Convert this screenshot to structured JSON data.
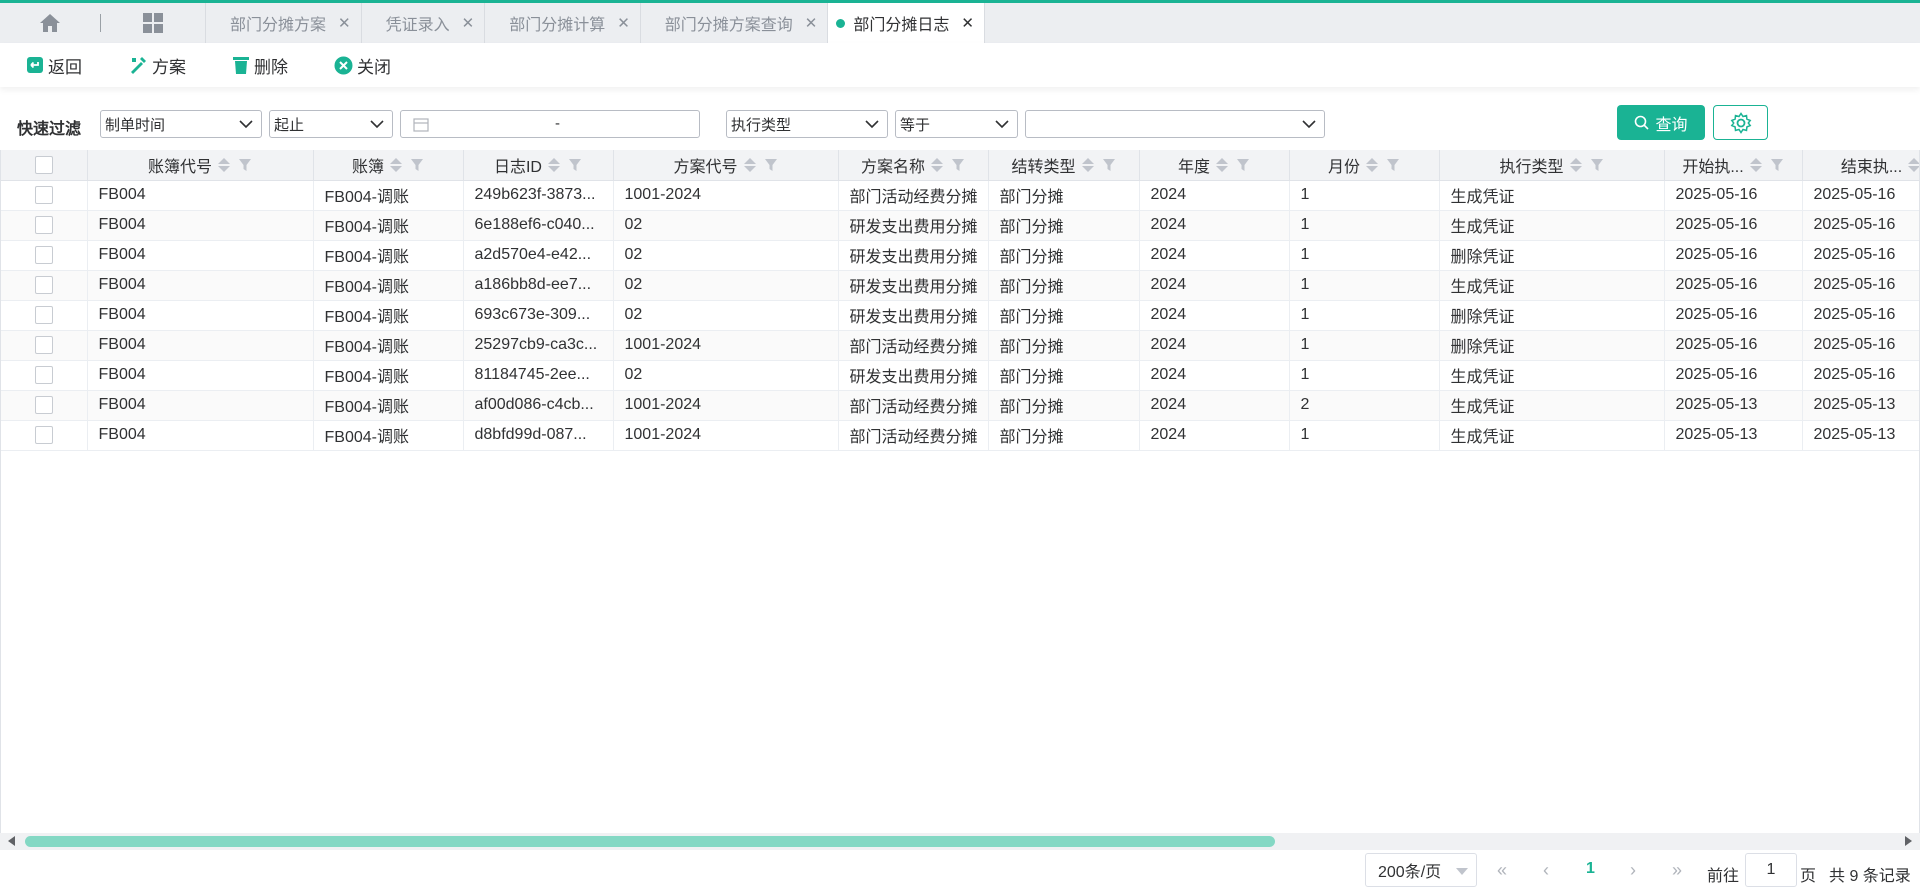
{
  "tabs": [
    {
      "label": "部门分摊方案",
      "active": false
    },
    {
      "label": "凭证录入",
      "active": false
    },
    {
      "label": "部门分摊计算",
      "active": false
    },
    {
      "label": "部门分摊方案查询",
      "active": false
    },
    {
      "label": "部门分摊日志",
      "active": true
    }
  ],
  "toolbar": {
    "back": "返回",
    "scheme": "方案",
    "delete": "删除",
    "close": "关闭"
  },
  "filter": {
    "label": "快速过滤",
    "field1": "制单时间",
    "range": "起止",
    "date_sep": "-",
    "field2": "执行类型",
    "operator": "等于",
    "value": "",
    "query_button": "查询"
  },
  "table": {
    "columns": [
      "账簿代号",
      "账簿",
      "日志ID",
      "方案代号",
      "方案名称",
      "结转类型",
      "年度",
      "月份",
      "执行类型",
      "开始执...",
      "结束执..."
    ],
    "rows": [
      [
        "FB004",
        "FB004-调账",
        "249b623f-3873...",
        "1001-2024",
        "部门活动经费分摊",
        "部门分摊",
        "2024",
        "1",
        "生成凭证",
        "2025-05-16",
        "2025-05-16"
      ],
      [
        "FB004",
        "FB004-调账",
        "6e188ef6-c040...",
        "02",
        "研发支出费用分摊",
        "部门分摊",
        "2024",
        "1",
        "生成凭证",
        "2025-05-16",
        "2025-05-16"
      ],
      [
        "FB004",
        "FB004-调账",
        "a2d570e4-e42...",
        "02",
        "研发支出费用分摊",
        "部门分摊",
        "2024",
        "1",
        "删除凭证",
        "2025-05-16",
        "2025-05-16"
      ],
      [
        "FB004",
        "FB004-调账",
        "a186bb8d-ee7...",
        "02",
        "研发支出费用分摊",
        "部门分摊",
        "2024",
        "1",
        "生成凭证",
        "2025-05-16",
        "2025-05-16"
      ],
      [
        "FB004",
        "FB004-调账",
        "693c673e-309...",
        "02",
        "研发支出费用分摊",
        "部门分摊",
        "2024",
        "1",
        "删除凭证",
        "2025-05-16",
        "2025-05-16"
      ],
      [
        "FB004",
        "FB004-调账",
        "25297cb9-ca3c...",
        "1001-2024",
        "部门活动经费分摊",
        "部门分摊",
        "2024",
        "1",
        "删除凭证",
        "2025-05-16",
        "2025-05-16"
      ],
      [
        "FB004",
        "FB004-调账",
        "81184745-2ee...",
        "02",
        "研发支出费用分摊",
        "部门分摊",
        "2024",
        "1",
        "生成凭证",
        "2025-05-16",
        "2025-05-16"
      ],
      [
        "FB004",
        "FB004-调账",
        "af00d086-c4cb...",
        "1001-2024",
        "部门活动经费分摊",
        "部门分摊",
        "2024",
        "2",
        "生成凭证",
        "2025-05-13",
        "2025-05-13"
      ],
      [
        "FB004",
        "FB004-调账",
        "d8bfd99d-087...",
        "1001-2024",
        "部门活动经费分摊",
        "部门分摊",
        "2024",
        "1",
        "生成凭证",
        "2025-05-13",
        "2025-05-13"
      ]
    ]
  },
  "pager": {
    "page_size": "200条/页",
    "current_page": "1",
    "goto_label": "前往",
    "goto_value": "1",
    "page_label": "页",
    "total": "共 9 条记录"
  },
  "colors": {
    "accent": "#1ab394",
    "scroll_thumb": "#84d8c4"
  }
}
